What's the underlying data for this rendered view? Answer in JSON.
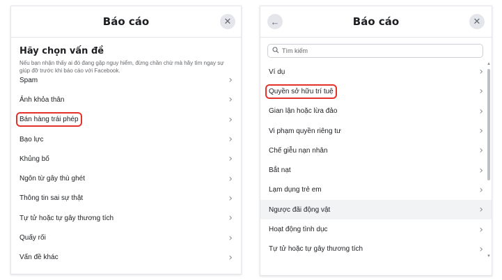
{
  "left": {
    "title": "Báo cáo",
    "close_glyph": "✕",
    "heading": "Hãy chọn vấn đề",
    "description": "Nếu bạn nhận thấy ai đó đang gặp nguy hiểm, đừng chần chừ mà hãy tìm ngay sự giúp đỡ trước khi báo cáo với Facebook.",
    "items": [
      {
        "label": "Spam"
      },
      {
        "label": "Ảnh khỏa thân"
      },
      {
        "label": "Bán hàng trái phép",
        "boxed": true
      },
      {
        "label": "Bạo lực"
      },
      {
        "label": "Khủng bố"
      },
      {
        "label": "Ngôn từ gây thù ghét"
      },
      {
        "label": "Thông tin sai sự thật"
      },
      {
        "label": "Tự tử hoặc tự gây thương tích"
      },
      {
        "label": "Quấy rối"
      },
      {
        "label": "Vấn đề khác"
      }
    ]
  },
  "right": {
    "title": "Báo cáo",
    "back_glyph": "←",
    "close_glyph": "✕",
    "search_placeholder": "Tìm kiếm",
    "items": [
      {
        "label": "Ví dụ"
      },
      {
        "label": "Quyền sở hữu trí tuệ",
        "boxed": true
      },
      {
        "label": "Gian lận hoặc lừa đảo"
      },
      {
        "label": "Vi phạm quyền riêng tư"
      },
      {
        "label": "Chế giễu nạn nhân"
      },
      {
        "label": "Bắt nạt"
      },
      {
        "label": "Lạm dụng trẻ em"
      },
      {
        "label": "Ngược đãi động vật",
        "highlighted": true
      },
      {
        "label": "Hoạt động tình dục"
      },
      {
        "label": "Tự tử hoặc tự gây thương tích"
      }
    ]
  },
  "icons": {
    "chevron": "chevron-right-icon",
    "search": "search-icon",
    "close": "close-icon",
    "back": "back-arrow-icon"
  },
  "colors": {
    "highlight_box": "#e4322b",
    "hover_row": "#f2f3f5"
  }
}
